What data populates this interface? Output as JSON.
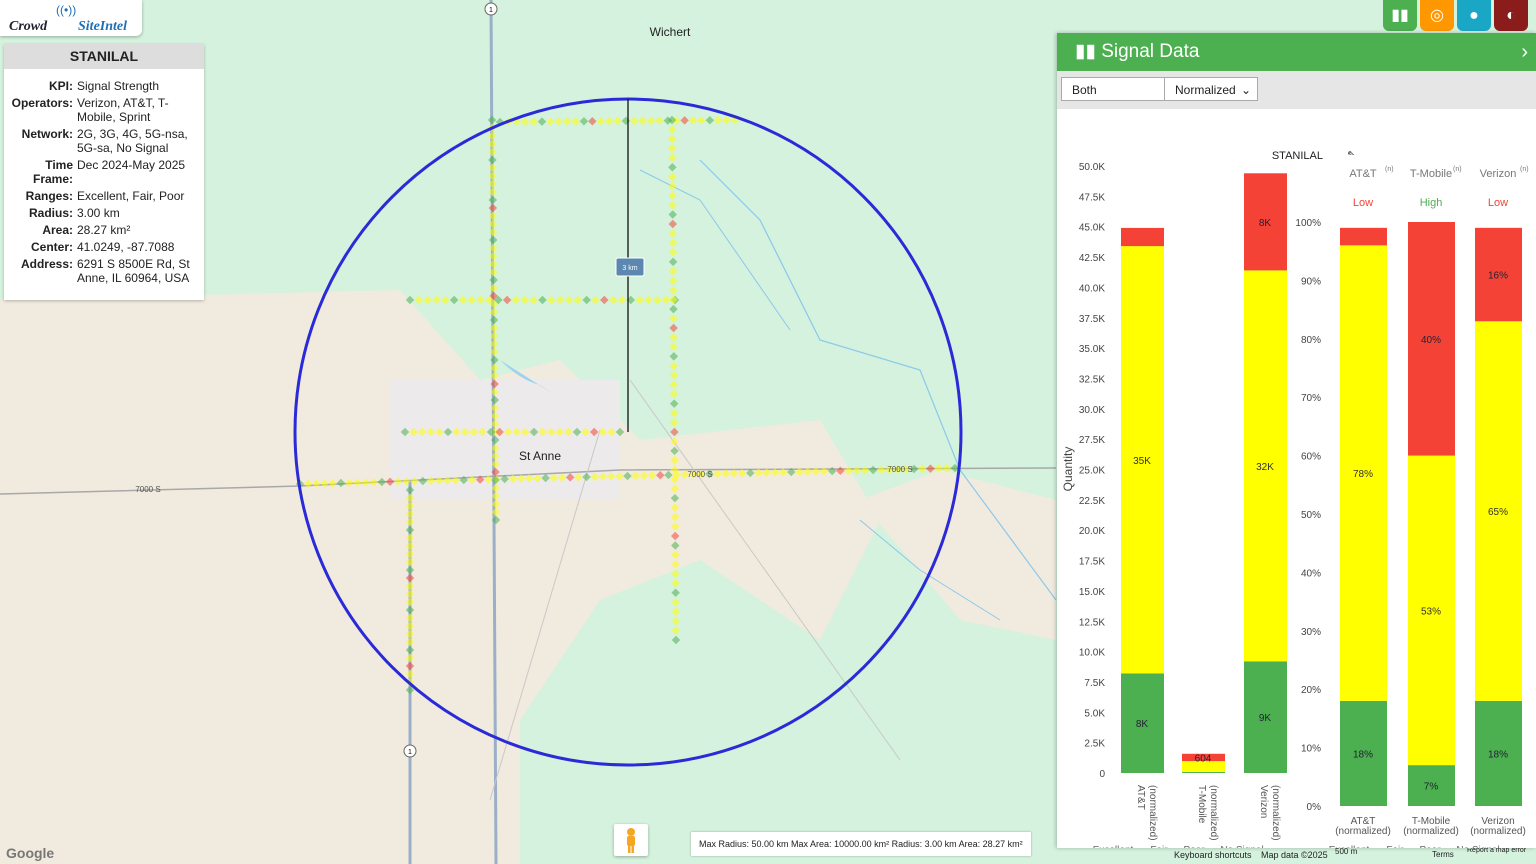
{
  "logo": {
    "text_a": "Crowd",
    "text_b": "SiteIntel"
  },
  "site": {
    "name": "STANILAL",
    "fields": [
      {
        "k": "KPI:",
        "v": "Signal Strength"
      },
      {
        "k": "Operators:",
        "v": "Verizon, AT&T, T-Mobile, Sprint"
      },
      {
        "k": "Network:",
        "v": "2G, 3G, 4G, 5G-nsa, 5G-sa, No Signal"
      },
      {
        "k": "Time Frame:",
        "v": "Dec 2024-May 2025"
      },
      {
        "k": "Ranges:",
        "v": "Excellent, Fair, Poor"
      },
      {
        "k": "Radius:",
        "v": "3.00 km"
      },
      {
        "k": "Area:",
        "v": "28.27 km²"
      },
      {
        "k": "Center:",
        "v": "41.0249, -87.7088"
      },
      {
        "k": "Address:",
        "v": "6291 S 8500E Rd, St Anne, IL 60964, USA"
      }
    ]
  },
  "map": {
    "place_wichert": "Wichert",
    "place_stanne": "St Anne",
    "road_7000": "7000 S",
    "radius_label": "3 km",
    "route_1": "1",
    "google": "Google",
    "status": "Max Radius: 50.00 km Max Area: 10000.00 km² Radius: 3.00 km Area: 28.27 km²",
    "keyboard": "Keyboard shortcuts",
    "mapdata": "Map data ©2025",
    "scale": "500 m",
    "terms": "Terms",
    "report": "Report a map error"
  },
  "panel": {
    "title": "Signal Data",
    "filter_value": "Both",
    "mode_value": "Normalized",
    "chart_title": "STANILAL"
  },
  "colors": {
    "excellent": "#4caf50",
    "fair": "#ffff00",
    "poor": "#f44336",
    "nosignal": "#bdbdbd",
    "circle": "#2a2ad8",
    "header": "#4caf50"
  },
  "chart_data": [
    {
      "type": "bar",
      "stacked": true,
      "ylabel": "Quantity",
      "ylim": [
        0,
        50000
      ],
      "yticks": [
        "0",
        "2.5K",
        "5.0K",
        "7.5K",
        "10.0K",
        "12.5K",
        "15.0K",
        "17.5K",
        "20.0K",
        "22.5K",
        "25.0K",
        "27.5K",
        "30.0K",
        "32.5K",
        "35.0K",
        "37.5K",
        "40.0K",
        "42.5K",
        "45.0K",
        "47.5K",
        "50.0K"
      ],
      "categories": [
        "AT&T (normalized)",
        "T-Mobile (normalized)",
        "Verizon (normalized)"
      ],
      "series": [
        {
          "name": "Excellent",
          "values": [
            8200,
            80,
            9200
          ]
        },
        {
          "name": "Fair",
          "values": [
            35200,
            900,
            32200
          ]
        },
        {
          "name": "Poor",
          "values": [
            1500,
            604,
            8000
          ]
        }
      ],
      "bar_labels": [
        [
          "8K",
          "35K",
          ""
        ],
        [
          "",
          "",
          "604"
        ],
        [
          "9K",
          "32K",
          "8K"
        ]
      ],
      "legend": [
        "Excellent",
        "Fair",
        "Poor",
        "No Signal"
      ]
    },
    {
      "type": "bar",
      "stacked": true,
      "ylim": [
        0,
        100
      ],
      "yticks": [
        "0%",
        "10%",
        "20%",
        "30%",
        "40%",
        "50%",
        "60%",
        "70%",
        "80%",
        "90%",
        "100%"
      ],
      "columns": [
        {
          "name": "AT&T",
          "sup": "(n)",
          "rating": "Low"
        },
        {
          "name": "T-Mobile",
          "sup": "(n)",
          "rating": "High"
        },
        {
          "name": "Verizon",
          "sup": "(n)",
          "rating": "Low"
        }
      ],
      "categories": [
        "AT&T (normalized)",
        "T-Mobile (normalized)",
        "Verizon (normalized)"
      ],
      "series": [
        {
          "name": "Excellent",
          "values": [
            18,
            7,
            18
          ]
        },
        {
          "name": "Fair",
          "values": [
            78,
            53,
            65
          ]
        },
        {
          "name": "Poor",
          "values": [
            3,
            40,
            16
          ]
        }
      ],
      "bar_labels": [
        [
          "18%",
          "78%",
          ""
        ],
        [
          "7%",
          "53%",
          "40%"
        ],
        [
          "18%",
          "65%",
          "16%"
        ]
      ],
      "legend": [
        "Excellent",
        "Fair",
        "Poor",
        "No Signal"
      ]
    }
  ]
}
